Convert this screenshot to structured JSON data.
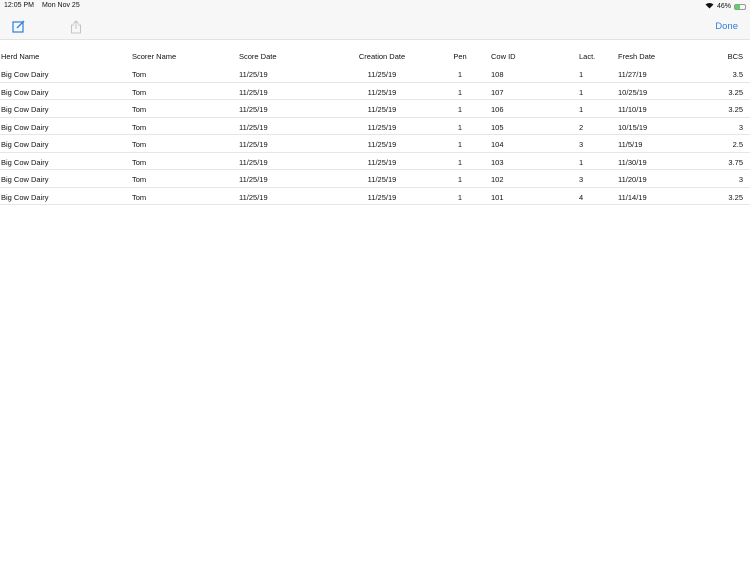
{
  "status_bar": {
    "time": "12:05 PM",
    "date": "Mon Nov 25",
    "battery": "46%",
    "battery_level": 0.46
  },
  "toolbar": {
    "done_label": "Done",
    "compose_icon": "compose-icon",
    "share_icon": "share-icon"
  },
  "table": {
    "columns": [
      "Herd Name",
      "Scorer Name",
      "Score Date",
      "Creation Date",
      "Pen",
      "Cow ID",
      "Lact.",
      "Fresh Date",
      "BCS"
    ],
    "rows": [
      [
        "Big Cow Dairy",
        "Tom",
        "11/25/19",
        "11/25/19",
        "1",
        "108",
        "1",
        "11/27/19",
        "3.5"
      ],
      [
        "Big Cow Dairy",
        "Tom",
        "11/25/19",
        "11/25/19",
        "1",
        "107",
        "1",
        "10/25/19",
        "3.25"
      ],
      [
        "Big Cow Dairy",
        "Tom",
        "11/25/19",
        "11/25/19",
        "1",
        "106",
        "1",
        "11/10/19",
        "3.25"
      ],
      [
        "Big Cow Dairy",
        "Tom",
        "11/25/19",
        "11/25/19",
        "1",
        "105",
        "2",
        "10/15/19",
        "3"
      ],
      [
        "Big Cow Dairy",
        "Tom",
        "11/25/19",
        "11/25/19",
        "1",
        "104",
        "3",
        "11/5/19",
        "2.5"
      ],
      [
        "Big Cow Dairy",
        "Tom",
        "11/25/19",
        "11/25/19",
        "1",
        "103",
        "1",
        "11/30/19",
        "3.75"
      ],
      [
        "Big Cow Dairy",
        "Tom",
        "11/25/19",
        "11/25/19",
        "1",
        "102",
        "3",
        "11/20/19",
        "3"
      ],
      [
        "Big Cow Dairy",
        "Tom",
        "11/25/19",
        "11/25/19",
        "1",
        "101",
        "4",
        "11/14/19",
        "3.25"
      ]
    ]
  }
}
